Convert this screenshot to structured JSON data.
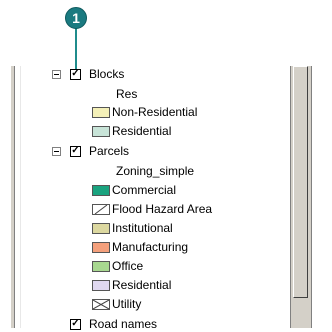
{
  "callout": {
    "number": "1",
    "color": "#1a7a80"
  },
  "toc": {
    "layers": [
      {
        "name": "Blocks",
        "checked": true,
        "field": "Res",
        "classes": [
          {
            "label": "Non-Residential",
            "color": "#f4f0b8"
          },
          {
            "label": "Residential",
            "color": "#c8e4d8"
          }
        ]
      },
      {
        "name": "Parcels",
        "checked": true,
        "field": "Zoning_simple",
        "classes": [
          {
            "label": "Commercial",
            "color": "#1aa37f"
          },
          {
            "label": "Flood Hazard Area",
            "color": "#ffffff",
            "icon": "hatch-icon"
          },
          {
            "label": "Institutional",
            "color": "#dcd8a0"
          },
          {
            "label": "Manufacturing",
            "color": "#f4a07c"
          },
          {
            "label": "Office",
            "color": "#a8d890"
          },
          {
            "label": "Residential",
            "color": "#e0d8f0"
          },
          {
            "label": "Utility",
            "color": "#ffffff",
            "icon": "cross-hatch-icon"
          }
        ]
      },
      {
        "name": "Road names",
        "checked": true
      }
    ]
  }
}
